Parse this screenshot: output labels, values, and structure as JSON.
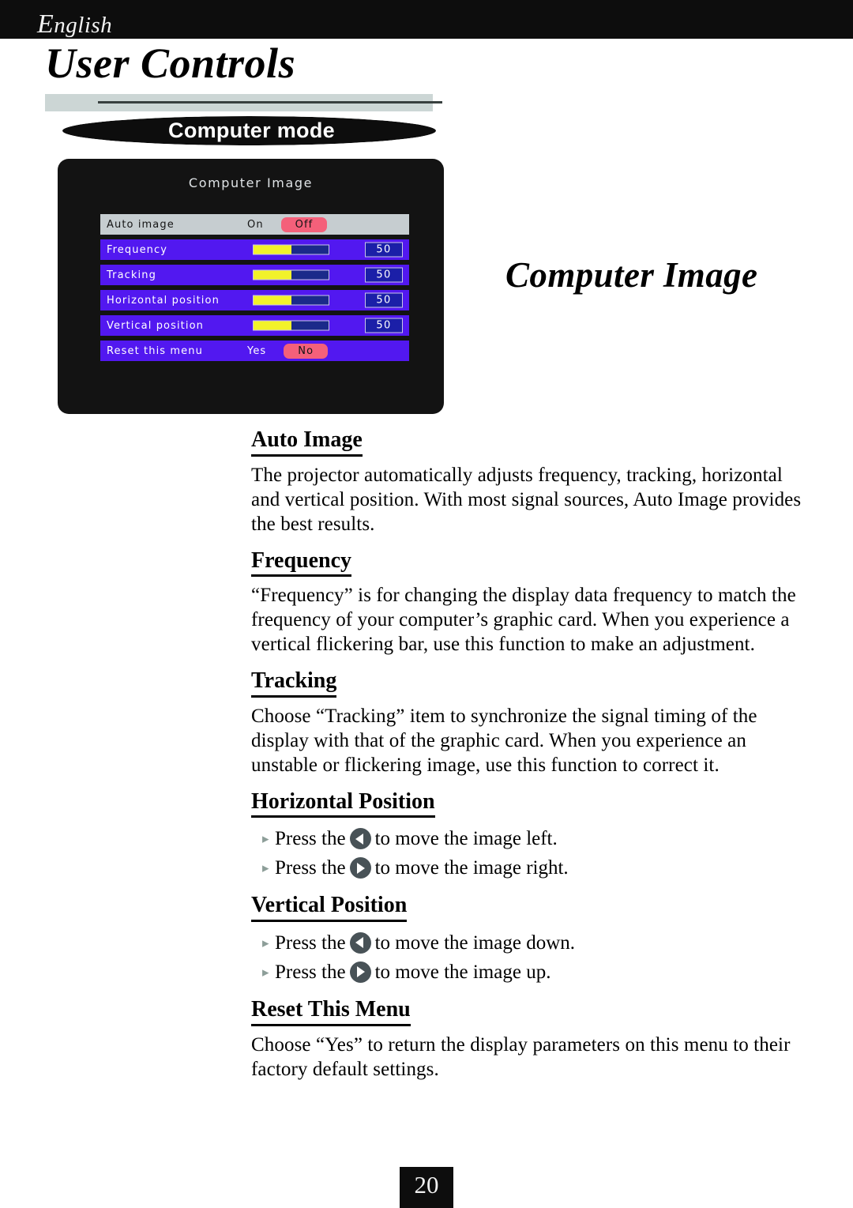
{
  "header": {
    "language": "English",
    "language_cap": "E",
    "language_rest": "nglish"
  },
  "page_title": "User Controls",
  "banner": {
    "label": "Computer mode"
  },
  "osd": {
    "title": "Computer Image",
    "rows": [
      {
        "label": "Auto image",
        "type": "options",
        "selected_row": true,
        "options": [
          {
            "label": "On",
            "active": false
          },
          {
            "label": "Off",
            "active": true
          }
        ]
      },
      {
        "label": "Frequency",
        "type": "slider",
        "selected_row": false,
        "value": "50",
        "fill_percent": 50
      },
      {
        "label": "Tracking",
        "type": "slider",
        "selected_row": false,
        "value": "50",
        "fill_percent": 50
      },
      {
        "label": "Horizontal position",
        "type": "slider",
        "selected_row": false,
        "value": "50",
        "fill_percent": 50
      },
      {
        "label": "Vertical position",
        "type": "slider",
        "selected_row": false,
        "value": "50",
        "fill_percent": 50
      },
      {
        "label": "Reset this menu",
        "type": "options",
        "selected_row": false,
        "options": [
          {
            "label": "Yes",
            "active": false
          },
          {
            "label": "No",
            "active": true
          }
        ]
      }
    ]
  },
  "section_title_right": "Computer Image",
  "sections": {
    "auto_image": {
      "heading": "Auto Image",
      "body": "The projector automatically adjusts frequency, tracking, horizontal and vertical position. With most signal sources, Auto Image provides the best results."
    },
    "frequency": {
      "heading": "Frequency",
      "body": "“Frequency” is for changing the display data frequency to match the frequency of your computer’s graphic card. When you experience a vertical flickering bar, use this function to make an adjustment."
    },
    "tracking": {
      "heading": "Tracking",
      "body": "Choose “Tracking” item to synchronize the signal timing of the display with that of the graphic card. When you experience an unstable or flickering image, use this function to correct it."
    },
    "horizontal_position": {
      "heading": "Horizontal Position",
      "bullets": [
        {
          "pre": "Press the",
          "icon": "arrow-left-button",
          "post": "to move the image left."
        },
        {
          "pre": "Press the",
          "icon": "arrow-right-button",
          "post": "to move the image right."
        }
      ]
    },
    "vertical_position": {
      "heading": "Vertical Position",
      "bullets": [
        {
          "pre": "Press the",
          "icon": "arrow-left-button",
          "post": "to move the image down."
        },
        {
          "pre": "Press the",
          "icon": "arrow-right-button",
          "post": "to move the image up."
        }
      ]
    },
    "reset_this_menu": {
      "heading": "Reset This Menu",
      "body": "Choose “Yes” to return the display parameters on this menu to their factory default settings."
    }
  },
  "footer": {
    "page_number": "20"
  },
  "colors": {
    "header_black": "#0d0d0d",
    "gray_bar": "#ccd6d5",
    "osd_background": "#131313",
    "osd_row_blue": "#5218f0",
    "osd_row_selected": "#c6cdd0",
    "osd_active_pill": "#f4607a",
    "slider_fill": "#f2f22a",
    "slider_track": "#1b2a8a",
    "nav_button": "#485257",
    "bullet_marker": "#8d9e99"
  }
}
